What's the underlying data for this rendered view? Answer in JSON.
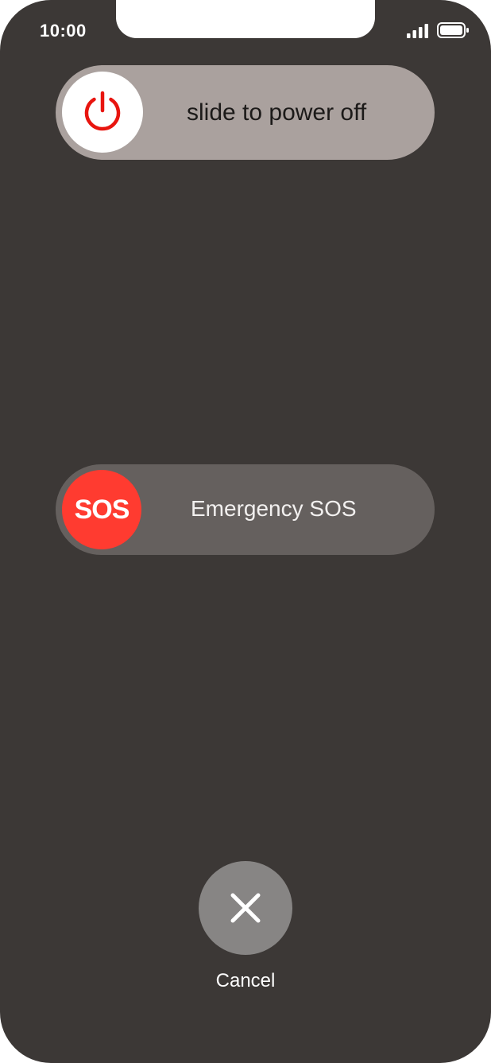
{
  "status_bar": {
    "time": "10:00",
    "signal_icon": "cellular-signal-icon",
    "battery_icon": "battery-icon"
  },
  "power_off": {
    "label": "slide to power off",
    "icon": "power-icon",
    "icon_color": "#e8150f"
  },
  "emergency": {
    "knob_label": "SOS",
    "label": "Emergency SOS",
    "knob_color": "#ff3b30"
  },
  "cancel": {
    "icon": "close-icon",
    "label": "Cancel"
  }
}
